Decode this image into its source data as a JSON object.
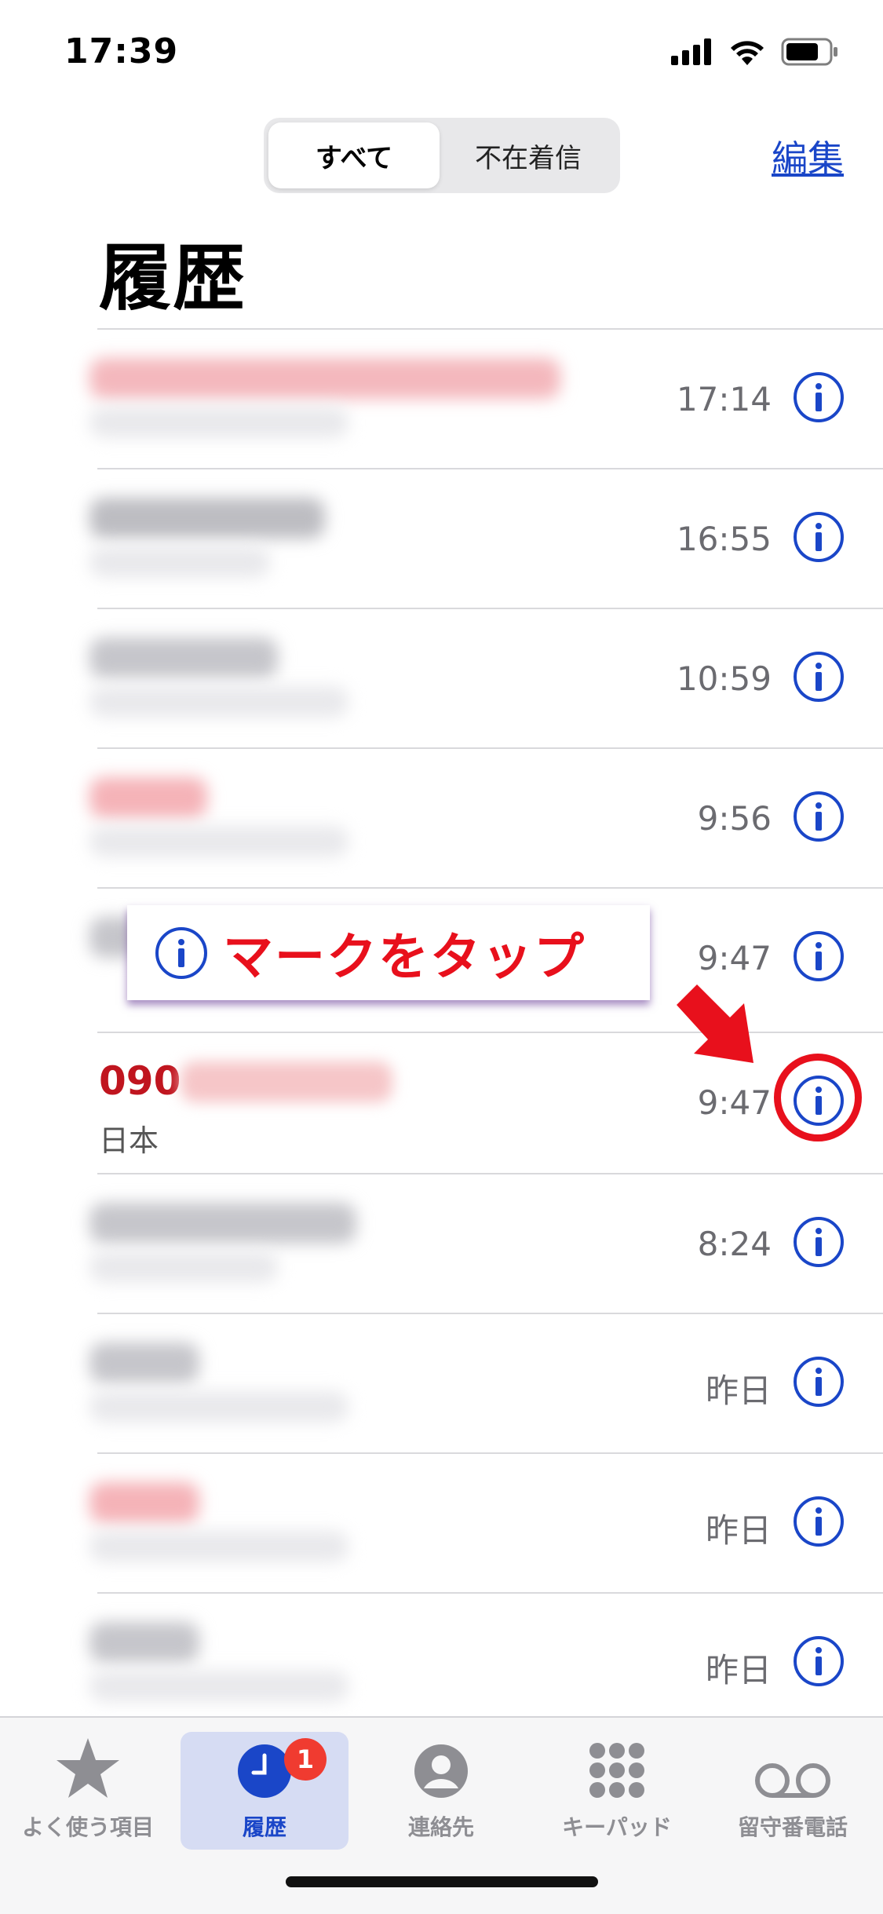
{
  "status": {
    "time": "17:39"
  },
  "header": {
    "segments": [
      "すべて",
      "不在着信"
    ],
    "edit_label": "編集",
    "title": "履歴"
  },
  "calls": [
    {
      "time": "17:14",
      "blur_color": "#f4b8bd"
    },
    {
      "time": "16:55",
      "blur_color": "#bdbdc2"
    },
    {
      "time": "10:59",
      "blur_color": "#c6c6cb"
    },
    {
      "time": "9:56",
      "blur_color": "#f5b3b8"
    },
    {
      "time": "9:47",
      "blur_color": "#c6c6cb"
    },
    {
      "time": "9:47",
      "number_prefix": "090",
      "location": "日本"
    },
    {
      "time": "8:24",
      "blur_color": "#c6c6cb"
    },
    {
      "time": "昨日",
      "blur_color": "#c6c6cb"
    },
    {
      "time": "昨日",
      "blur_color": "#f5b3b8"
    },
    {
      "time": "昨日",
      "blur_color": "#c6c6cb"
    }
  ],
  "callout": {
    "text": "マークをタップ"
  },
  "tabs": [
    {
      "label": "よく使う項目",
      "icon": "star-icon"
    },
    {
      "label": "履歴",
      "icon": "clock-icon",
      "badge": "1"
    },
    {
      "label": "連絡先",
      "icon": "person-icon"
    },
    {
      "label": "キーパッド",
      "icon": "keypad-icon"
    },
    {
      "label": "留守番電話",
      "icon": "voicemail-icon"
    }
  ],
  "colors": {
    "accent": "#1a46c8",
    "missed": "#c0151f",
    "annotation": "#e8101c",
    "badge": "#f03b30"
  }
}
